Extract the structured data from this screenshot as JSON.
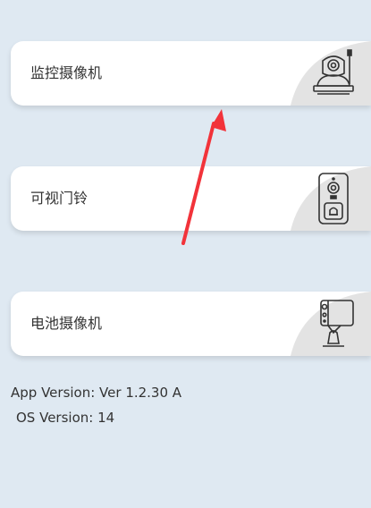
{
  "devices": [
    {
      "label": "监控摄像机",
      "icon": "ptz-camera-icon"
    },
    {
      "label": "可视门铃",
      "icon": "doorbell-icon"
    },
    {
      "label": "电池摄像机",
      "icon": "battery-camera-icon"
    }
  ],
  "footer": {
    "app_version": "App Version: Ver 1.2.30 A",
    "os_version": "OS Version: 14"
  },
  "colors": {
    "background": "#dfe9f2",
    "card": "#ffffff",
    "swoosh": "#e3e3e3",
    "annotation_arrow": "#f2333a"
  }
}
